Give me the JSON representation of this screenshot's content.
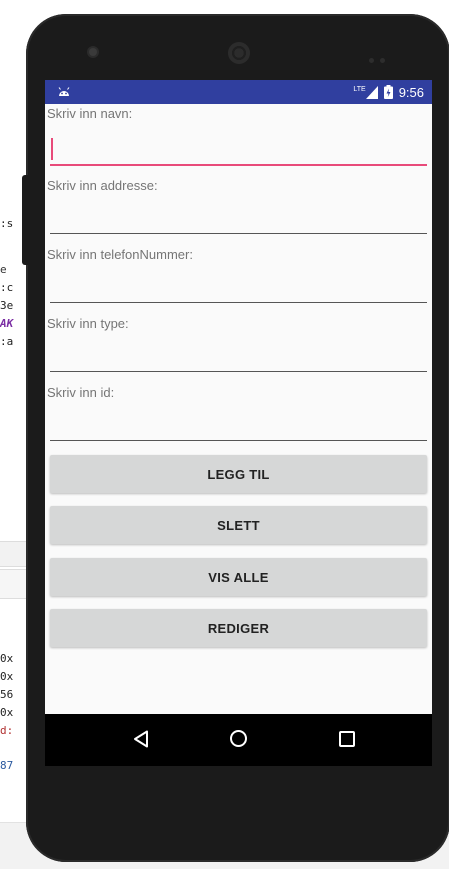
{
  "ide": {
    "code_fragments": [
      ":s",
      "e",
      ":c",
      "3e",
      "AK",
      ":a",
      "0x",
      "0x",
      "56",
      "0x",
      "d:",
      "87"
    ]
  },
  "statusbar": {
    "network": "LTE",
    "time": "9:56"
  },
  "form": {
    "fields": [
      {
        "label": "Skriv inn navn:"
      },
      {
        "label": "Skriv inn addresse:"
      },
      {
        "label": "Skriv inn telefonNummer:"
      },
      {
        "label": "Skriv inn type:"
      },
      {
        "label": "Skriv inn id:"
      }
    ],
    "buttons": [
      {
        "label": "LEGG TIL"
      },
      {
        "label": "SLETT"
      },
      {
        "label": "VIS ALLE"
      },
      {
        "label": "REDIGER"
      }
    ]
  },
  "colors": {
    "statusbar": "#303f9f",
    "accent": "#e84a7a",
    "button": "#d6d7d7"
  },
  "icons": [
    "android-icon",
    "lte-signal-icon",
    "battery-icon",
    "back-icon",
    "home-icon",
    "recent-apps-icon"
  ]
}
